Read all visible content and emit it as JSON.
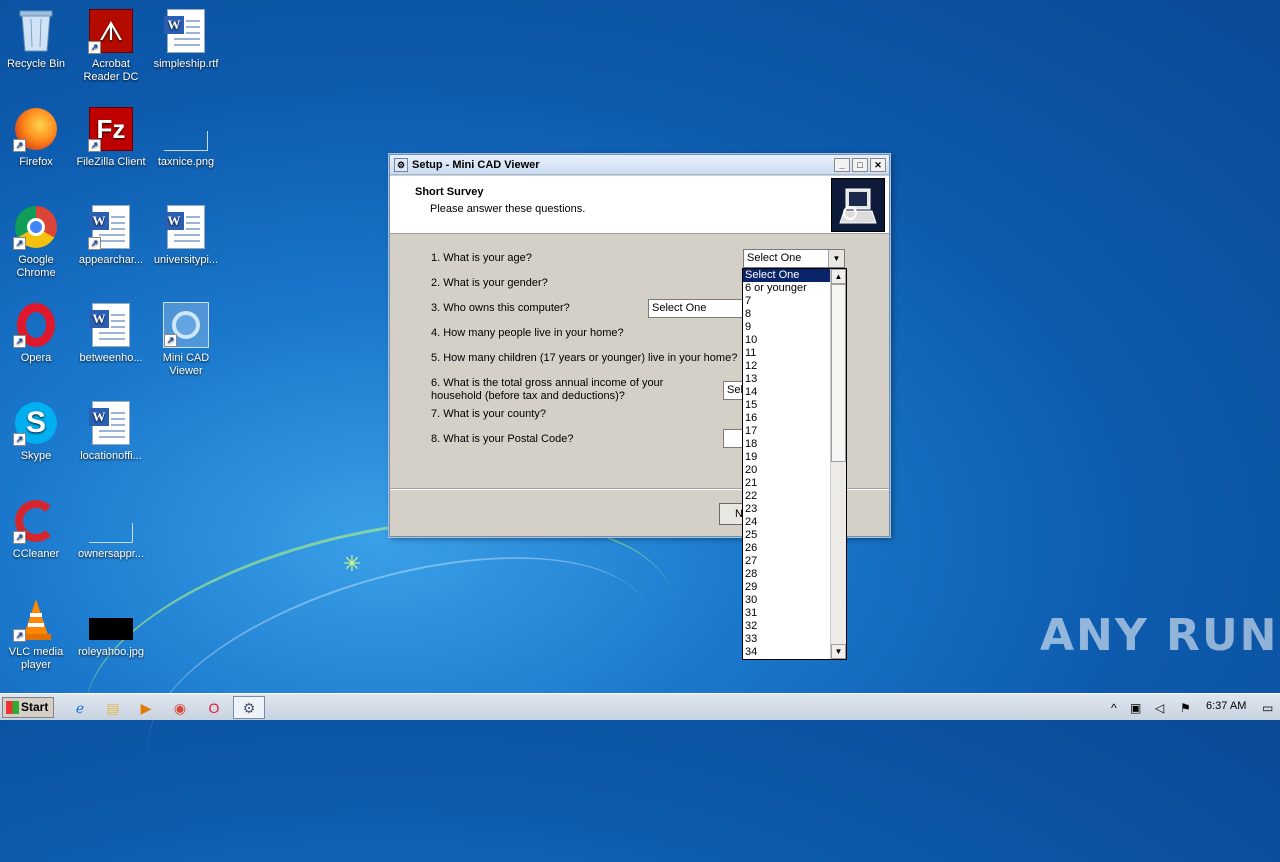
{
  "desktop": {
    "icons": [
      {
        "label": "Recycle Bin"
      },
      {
        "label": "Acrobat Reader DC"
      },
      {
        "label": "simpleship.rtf"
      },
      {
        "label": "Firefox"
      },
      {
        "label": "FileZilla Client"
      },
      {
        "label": "taxnice.png"
      },
      {
        "label": "Google Chrome"
      },
      {
        "label": "appearchar..."
      },
      {
        "label": "universitypi..."
      },
      {
        "label": "Opera"
      },
      {
        "label": "betweenho..."
      },
      {
        "label": "Mini CAD Viewer"
      },
      {
        "label": "Skype"
      },
      {
        "label": "locationoffi..."
      },
      {
        "label": "CCleaner"
      },
      {
        "label": "ownersappr..."
      },
      {
        "label": "VLC media player"
      },
      {
        "label": "roleyahoo.jpg"
      }
    ]
  },
  "window": {
    "title": "Setup - Mini CAD Viewer",
    "header_title": "Short Survey",
    "header_subtitle": "Please answer these questions.",
    "questions": [
      {
        "text": "1. What is your age?"
      },
      {
        "text": "2. What is your gender?"
      },
      {
        "text": "3. Who owns this computer?"
      },
      {
        "text": "4. How many people live in your home?"
      },
      {
        "text": "5. How many children (17 years or younger) live in your home?"
      },
      {
        "text": "6. What is the total gross annual income of your household (before tax and deductions)?"
      },
      {
        "text": "7. What is your county?"
      },
      {
        "text": "8. What is your Postal Code?"
      }
    ],
    "age_select_value": "Select One",
    "owner_select_value": "Select One",
    "income_select_partial": "Sele",
    "next_button_partial": "N"
  },
  "dropdown": {
    "options": [
      "Select One",
      "6 or younger",
      "7",
      "8",
      "9",
      "10",
      "11",
      "12",
      "13",
      "14",
      "15",
      "16",
      "17",
      "18",
      "19",
      "20",
      "21",
      "22",
      "23",
      "24",
      "25",
      "26",
      "27",
      "28",
      "29",
      "30",
      "31",
      "32",
      "33",
      "34"
    ],
    "selected_index": 0
  },
  "taskbar": {
    "start_label": "Start",
    "clock": "6:37 AM"
  },
  "watermark": "ANY RUN"
}
